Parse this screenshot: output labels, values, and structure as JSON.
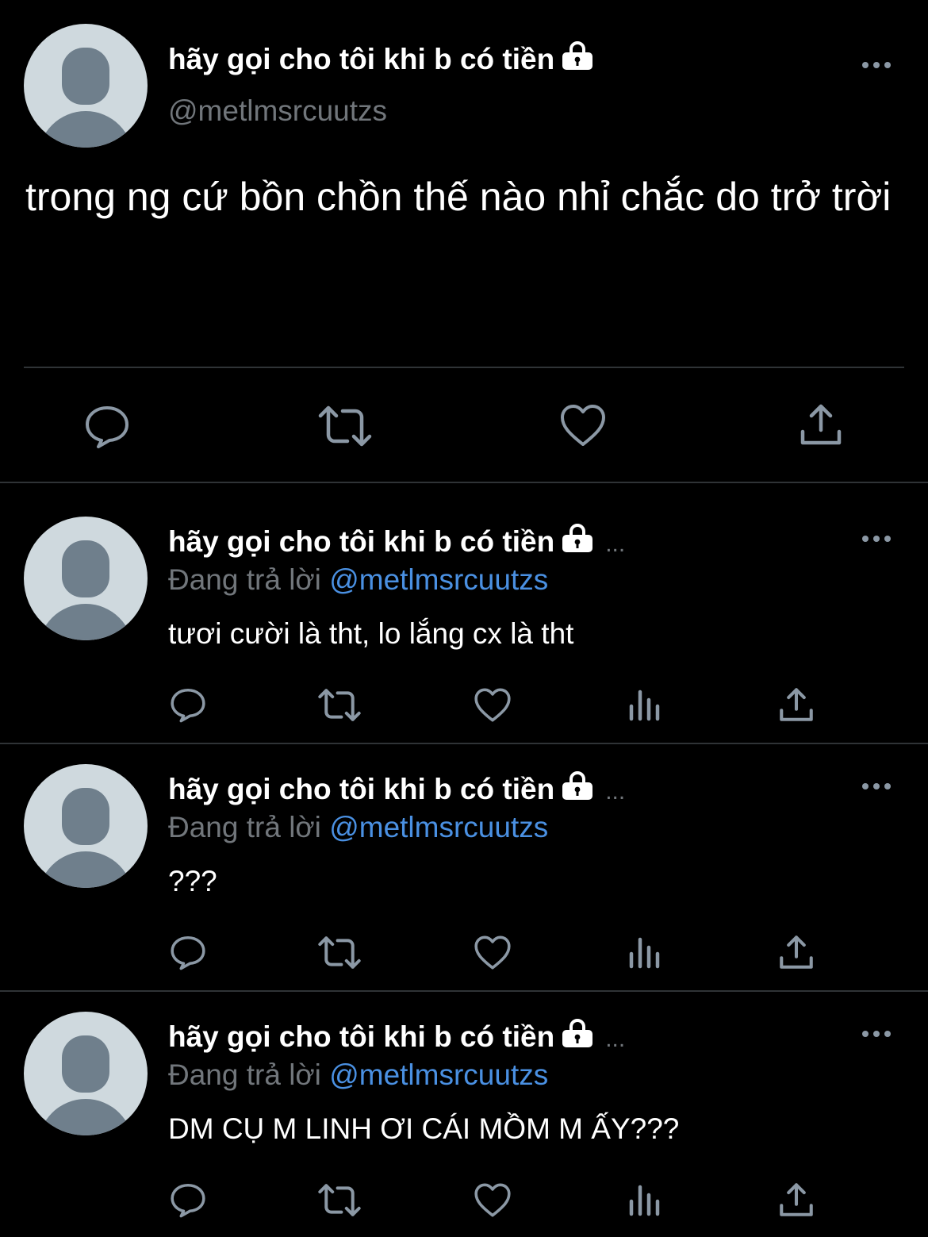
{
  "main_tweet": {
    "display_name": "hãy gọi cho tôi khi b có tiền",
    "handle": "@metlmsrcuutzs",
    "text": "trong ng cứ bồn chồn thế nào nhỉ chắc do trở trời",
    "icons": [
      "reply-icon",
      "retweet-icon",
      "like-icon",
      "share-icon"
    ]
  },
  "replies": [
    {
      "display_name": "hãy gọi cho tôi khi b có tiền",
      "ellipsis": "...",
      "replying_label": "Đang trả lời",
      "mention": "@metlmsrcuutzs",
      "text": "tươi cười là tht, lo lắng cx là tht"
    },
    {
      "display_name": "hãy gọi cho tôi khi b có tiền",
      "ellipsis": "...",
      "replying_label": "Đang trả lời",
      "mention": "@metlmsrcuutzs",
      "text": "???"
    },
    {
      "display_name": "hãy gọi cho tôi khi b có tiền",
      "ellipsis": "...",
      "replying_label": "Đang trả lời",
      "mention": "@metlmsrcuutzs",
      "text": "DM CỤ M LINH ƠI CÁI MỒM M ẤY???"
    }
  ],
  "colors": {
    "background": "#000000",
    "text": "#ffffff",
    "muted": "#71767b",
    "mention": "#4a90e2",
    "divider": "#2f3336"
  }
}
